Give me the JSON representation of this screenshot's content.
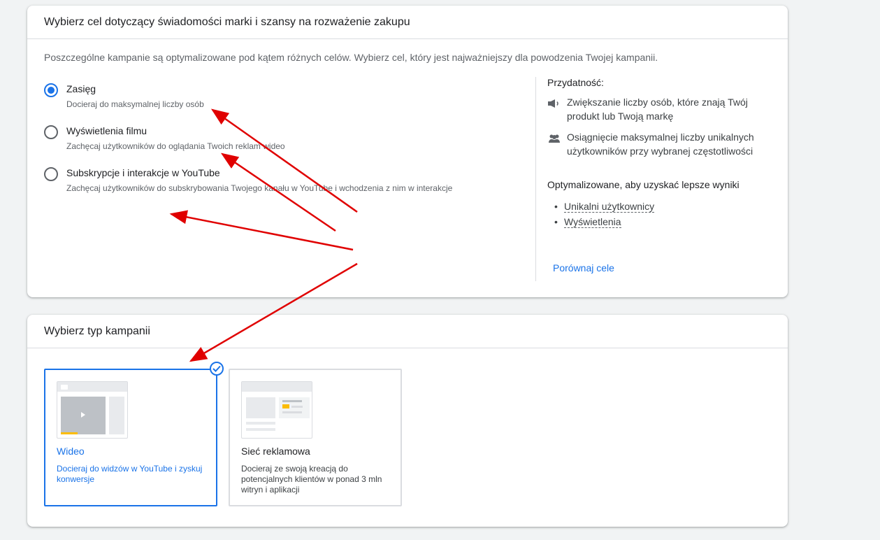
{
  "goal_card": {
    "title": "Wybierz cel dotyczący świadomości marki i szansy na rozważenie zakupu",
    "intro": "Poszczególne kampanie są optymalizowane pod kątem różnych celów. Wybierz cel, który jest najważniejszy dla powodzenia Twojej kampanii.",
    "options": [
      {
        "title": "Zasięg",
        "desc": "Docieraj do maksymalnej liczby osób",
        "selected": true
      },
      {
        "title": "Wyświetlenia filmu",
        "desc": "Zachęcaj użytkowników do oglądania Twoich reklam wideo",
        "selected": false
      },
      {
        "title": "Subskrypcje i interakcje w YouTube",
        "desc": "Zachęcaj użytkowników do subskrybowania Twojego kanału w YouTube i wchodzenia z nim w interakcje",
        "selected": false
      }
    ],
    "side": {
      "heading": "Przydatność:",
      "benefits": [
        {
          "icon": "megaphone-icon",
          "text": "Zwiększanie liczby osób, które znają Twój produkt lub Twoją markę"
        },
        {
          "icon": "people-group-icon",
          "text": "Osiągnięcie maksymalnej liczby unikalnych użytkowników przy wybranej częstotliwości"
        }
      ],
      "optimized_heading": "Optymalizowane, aby uzyskać lepsze wyniki",
      "optimized_items": [
        "Unikalni użytkownicy",
        "Wyświetlenia"
      ],
      "compare_link": "Porównaj cele"
    }
  },
  "campaign_card": {
    "title": "Wybierz typ kampanii",
    "tiles": [
      {
        "title": "Wideo",
        "desc": "Docieraj do widzów w YouTube i zyskuj konwersje",
        "selected": true
      },
      {
        "title": "Sieć reklamowa",
        "desc": "Docieraj ze swoją kreacją do potencjalnych klientów w ponad 3 mln witryn i aplikacji",
        "selected": false
      }
    ]
  },
  "colors": {
    "accent": "#1a73e8",
    "annotation_arrow": "#e00000",
    "video_progress": "#fbbc04"
  }
}
